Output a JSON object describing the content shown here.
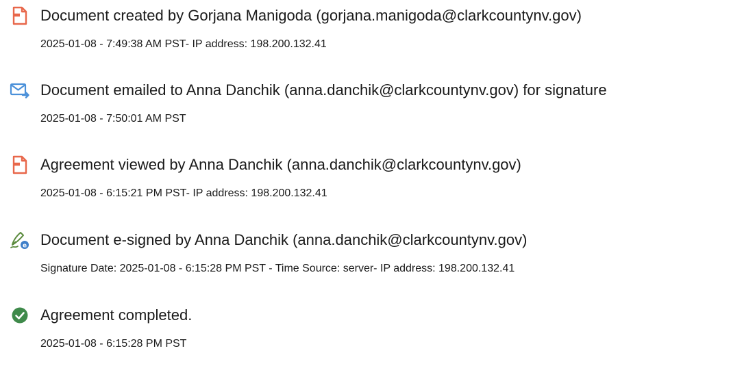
{
  "events": [
    {
      "icon": "document-created-icon",
      "title": "Document created by Gorjana Manigoda (gorjana.manigoda@clarkcountynv.gov)",
      "detail": "2025-01-08 - 7:49:38 AM PST- IP address: 198.200.132.41"
    },
    {
      "icon": "email-sent-icon",
      "title": "Document emailed to Anna Danchik (anna.danchik@clarkcountynv.gov) for signature",
      "detail": "2025-01-08 - 7:50:01 AM PST"
    },
    {
      "icon": "document-viewed-icon",
      "title": "Agreement viewed by Anna Danchik (anna.danchik@clarkcountynv.gov)",
      "detail": "2025-01-08 - 6:15:21 PM PST- IP address: 198.200.132.41"
    },
    {
      "icon": "e-sign-pen-icon",
      "title": "Document e-signed by Anna Danchik (anna.danchik@clarkcountynv.gov)",
      "detail": "Signature Date: 2025-01-08 - 6:15:28 PM PST - Time Source: server- IP address: 198.200.132.41"
    },
    {
      "icon": "check-circle-icon",
      "title": "Agreement completed.",
      "detail": "2025-01-08 - 6:15:28 PM PST"
    }
  ],
  "colors": {
    "document_icon": "#e8674a",
    "email_icon": "#4a90d9",
    "pen_icon": "#5a8a3c",
    "check_icon": "#3f8a4b",
    "text": "#1a1a1a"
  }
}
